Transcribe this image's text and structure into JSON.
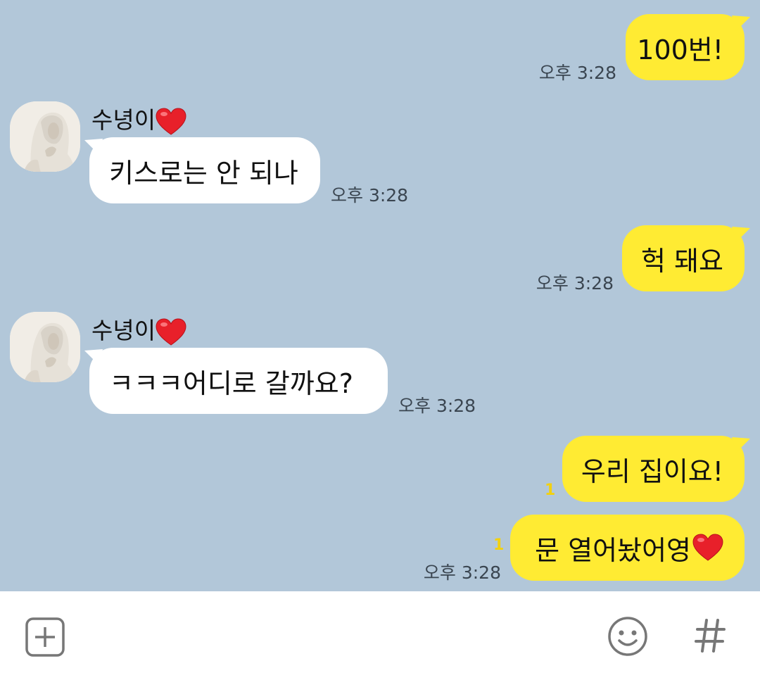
{
  "messages": [
    {
      "id": "m1",
      "sender": "me",
      "text": "100번!",
      "time": "오후 3:28"
    },
    {
      "id": "m2",
      "sender": "수녕이",
      "text": "키스로는 안 되나",
      "time": "오후 3:28"
    },
    {
      "id": "m3",
      "sender": "me",
      "text": "헉 돼요",
      "time": "오후 3:28"
    },
    {
      "id": "m4",
      "sender": "수녕이",
      "text": "ㅋㅋㅋ어디로 갈까요?",
      "time": "오후 3:28"
    },
    {
      "id": "m5",
      "sender": "me",
      "text": "우리 집이요!",
      "unread": "1"
    },
    {
      "id": "m6",
      "sender": "me",
      "text": "문 열어놨어영",
      "unread": "1",
      "time": "오후 3:28"
    }
  ],
  "contact": {
    "name": "수녕이",
    "name_suffix_icon": "red-heart-icon"
  },
  "input_bar": {
    "left_icon": "plus-box-icon",
    "emoji_icon": "smile-icon",
    "hash_icon": "hashtag-icon"
  },
  "colors": {
    "chat_background": "#b2c7d9",
    "my_bubble": "#ffeb33",
    "their_bubble": "#ffffff",
    "unread_count": "#f2d10f",
    "heart": "#e8202a"
  }
}
